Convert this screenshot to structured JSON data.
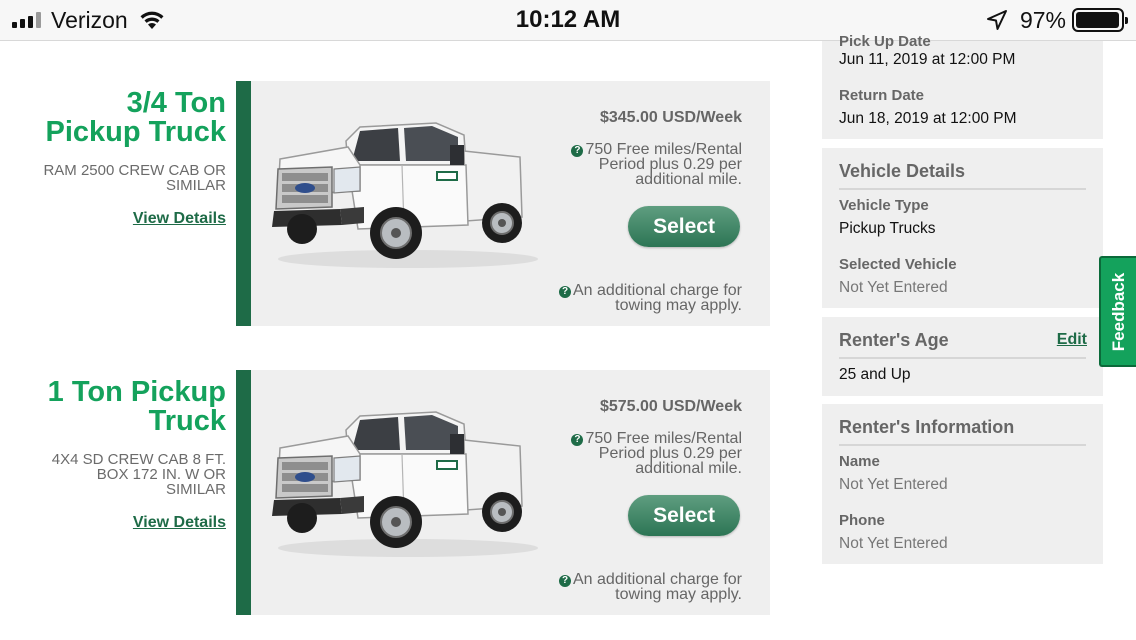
{
  "status_bar": {
    "carrier": "Verizon",
    "time": "10:12 AM",
    "battery_percent": "97%",
    "battery_level": 0.97,
    "icons": [
      "signal-icon",
      "wifi-icon",
      "location-arrow-icon",
      "battery-icon"
    ]
  },
  "vehicles": [
    {
      "title": "3/4 Ton Pickup Truck",
      "subtitle": "RAM 2500 CREW CAB OR SIMILAR",
      "details_link": "View Details",
      "price": "$345.00 USD/Week",
      "miles_note": "750 Free miles/Rental Period plus 0.29 per additional mile.",
      "select_label": "Select",
      "towing_note": "An additional charge for towing may apply."
    },
    {
      "title": "1 Ton Pickup Truck",
      "subtitle": "4X4 SD CREW CAB 8 FT. BOX 172 IN. W OR SIMILAR",
      "details_link": "View Details",
      "price": "$575.00 USD/Week",
      "miles_note": "750 Free miles/Rental Period plus 0.29 per additional mile.",
      "select_label": "Select",
      "towing_note": "An additional charge for towing may apply."
    }
  ],
  "sidebar": {
    "dates": {
      "pickup_label": "Pick Up Date",
      "pickup_value": "Jun 11, 2019 at 12:00 PM",
      "return_label": "Return Date",
      "return_value": "Jun 18, 2019 at 12:00 PM"
    },
    "vehicle_details": {
      "heading": "Vehicle Details",
      "type_label": "Vehicle Type",
      "type_value": "Pickup Trucks",
      "selected_label": "Selected Vehicle",
      "selected_value": "Not Yet Entered"
    },
    "renter_age": {
      "heading": "Renter's Age",
      "edit_label": "Edit",
      "value": "25 and Up"
    },
    "renter_info": {
      "heading": "Renter's Information",
      "name_label": "Name",
      "name_value": "Not Yet Entered",
      "phone_label": "Phone",
      "phone_value": "Not Yet Entered"
    }
  },
  "feedback_tab": "Feedback",
  "colors": {
    "brand_green": "#14a25c",
    "dark_green": "#1e6b47",
    "card_bg": "#efefef"
  }
}
